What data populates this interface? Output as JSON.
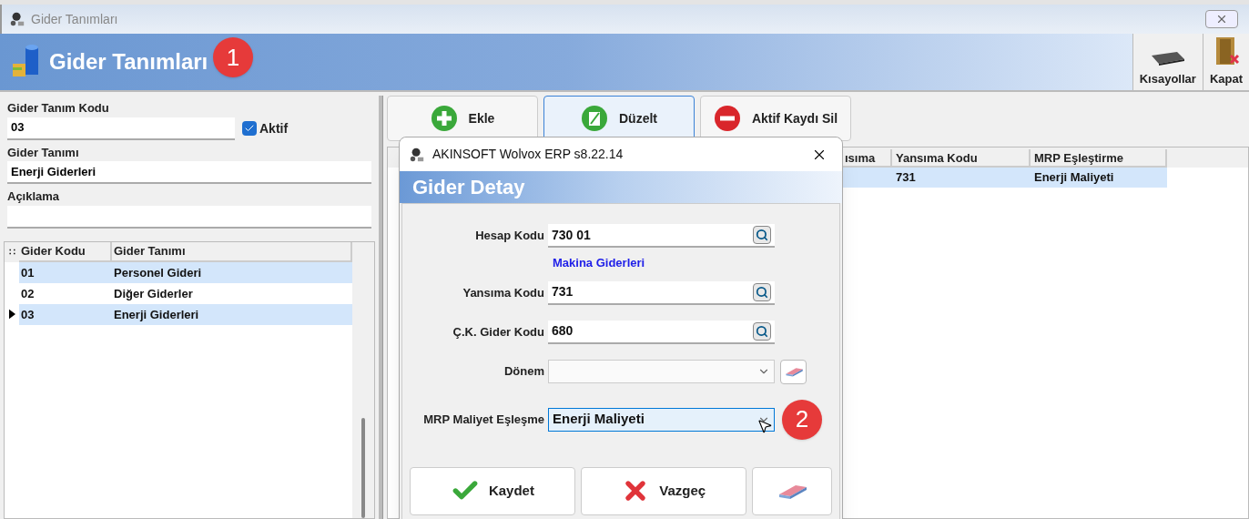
{
  "window": {
    "title": "Gider Tanımları"
  },
  "header": {
    "title": "Gider Tanımları",
    "toolbar": [
      {
        "label": "Kısayollar",
        "kind": "keyboard"
      },
      {
        "label": "Kapat",
        "kind": "door"
      }
    ]
  },
  "form": {
    "code_label": "Gider Tanım Kodu",
    "code_value": "03",
    "active": {
      "label": "Aktif",
      "checked": true
    },
    "name_label": "Gider Tanımı",
    "name_value": "Enerji Giderleri",
    "desc_label": "Açıklama"
  },
  "list": {
    "corner": "∷",
    "columns": [
      "Gider Kodu",
      "Gider Tanımı"
    ],
    "rows": [
      {
        "cells": [
          "01",
          "Personel Gideri"
        ],
        "selected": false
      },
      {
        "cells": [
          "02",
          "Diğer Giderler"
        ],
        "selected": false
      },
      {
        "cells": [
          "03",
          "Enerji Giderleri"
        ],
        "selected": true
      }
    ]
  },
  "actions": [
    {
      "label": "Ekle",
      "kind": "add",
      "focused": false
    },
    {
      "label": "Düzelt",
      "kind": "edit",
      "focused": true
    },
    {
      "label": "Aktif Kaydı Sil",
      "kind": "delete",
      "focused": false
    }
  ],
  "detail_grid": {
    "columns": [
      "ısıma",
      "Yansıma Kodu",
      "MRP Eşleştirme"
    ],
    "rows": [
      {
        "cells": [
          "",
          "731",
          "Enerji Maliyeti"
        ]
      }
    ]
  },
  "dialog": {
    "title": "AKINSOFT Wolvox ERP s8.22.14",
    "heading": "Gider Detay",
    "fields": [
      {
        "label": "Hesap Kodu",
        "kind": "lookup",
        "value": "730 01",
        "note": "Makina Giderleri"
      },
      {
        "label": "Yansıma Kodu",
        "kind": "lookup",
        "value": "731"
      },
      {
        "label": "Ç.K. Gider Kodu",
        "kind": "lookup",
        "value": "680"
      },
      {
        "label": "Dönem",
        "kind": "combo",
        "clear_button": true,
        "focused": false
      },
      {
        "label": "MRP Maliyet Eşleşme",
        "kind": "combo",
        "value": "Enerji Maliyeti",
        "focused": true
      }
    ],
    "buttons": [
      {
        "label": "Kaydet",
        "kind": "save"
      },
      {
        "label": "Vazgeç",
        "kind": "cancel"
      },
      {
        "kind": "clear"
      }
    ]
  },
  "annotations": [
    {
      "label": "1"
    },
    {
      "label": "2"
    }
  ]
}
